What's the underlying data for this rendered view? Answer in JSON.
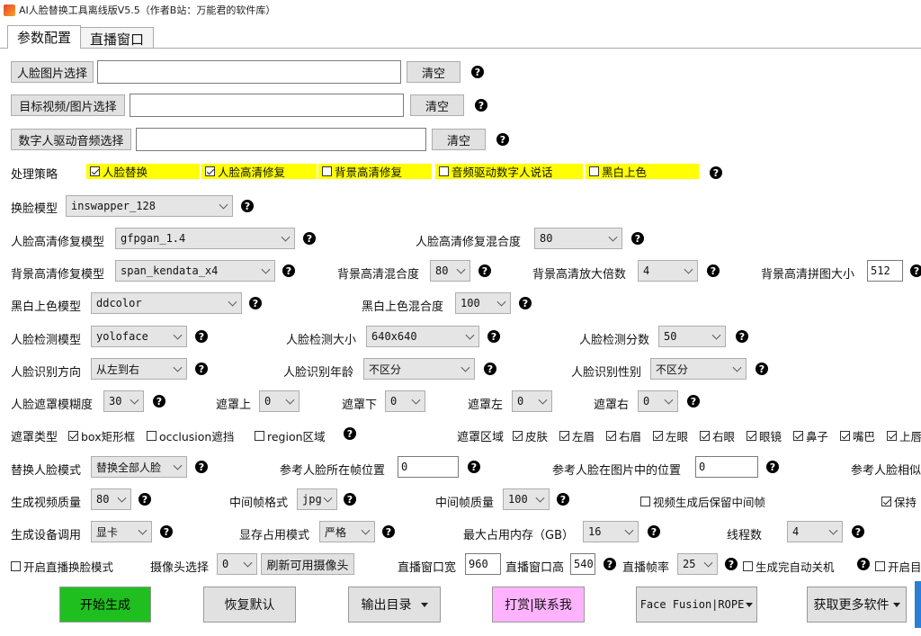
{
  "window": {
    "title": "AI人脸替换工具离线版V5.5（作者B站：万能君的软件库）"
  },
  "tabs": [
    "参数配置",
    "直播窗口"
  ],
  "file_rows": [
    {
      "button": "人脸图片选择",
      "value": "",
      "clear": "清空"
    },
    {
      "button": "目标视频/图片选择",
      "value": "",
      "clear": "清空"
    },
    {
      "button": "数字人驱动音频选择",
      "value": "",
      "clear": "清空"
    }
  ],
  "strategy": {
    "label": "处理策略",
    "options": [
      {
        "label": "人脸替换",
        "checked": true
      },
      {
        "label": "人脸高清修复",
        "checked": true
      },
      {
        "label": "背景高清修复",
        "checked": false
      },
      {
        "label": "音频驱动数字人说话",
        "checked": false
      },
      {
        "label": "黑白上色",
        "checked": false
      }
    ]
  },
  "swap_model": {
    "label": "换脸模型",
    "value": "inswapper_128"
  },
  "face_enhance": {
    "label": "人脸高清修复模型",
    "value": "gfpgan_1.4",
    "blend_label": "人脸高清修复混合度",
    "blend": "80"
  },
  "bg_enhance": {
    "label": "背景高清修复模型",
    "value": "span_kendata_x4",
    "blend_label": "背景高清混合度",
    "blend": "80",
    "scale_label": "背景高清放大倍数",
    "scale": "4",
    "tile_label": "背景高清拼图大小",
    "tile": "512"
  },
  "colorize": {
    "label": "黑白上色模型",
    "value": "ddcolor",
    "blend_label": "黑白上色混合度",
    "blend": "100"
  },
  "detect": {
    "label": "人脸检测模型",
    "value": "yoloface",
    "size_label": "人脸检测大小",
    "size": "640x640",
    "score_label": "人脸检测分数",
    "score": "50"
  },
  "recog": {
    "label": "人脸识别方向",
    "value": "从左到右",
    "age_label": "人脸识别年龄",
    "age": "不区分",
    "gender_label": "人脸识别性别",
    "gender": "不区分"
  },
  "mask": {
    "blur_label": "人脸遮罩模糊度",
    "blur": "30",
    "top_label": "遮罩上",
    "top": "0",
    "bottom_label": "遮罩下",
    "bottom": "0",
    "left_label": "遮罩左",
    "left": "0",
    "right_label": "遮罩右",
    "right": "0"
  },
  "mask_type": {
    "label": "遮罩类型",
    "options": [
      {
        "label": "box矩形框",
        "checked": true
      },
      {
        "label": "occlusion遮挡",
        "checked": false
      },
      {
        "label": "region区域",
        "checked": false
      }
    ]
  },
  "mask_region": {
    "label": "遮罩区域",
    "options": [
      {
        "label": "皮肤",
        "checked": true
      },
      {
        "label": "左眉",
        "checked": true
      },
      {
        "label": "右眉",
        "checked": true
      },
      {
        "label": "左眼",
        "checked": true
      },
      {
        "label": "右眼",
        "checked": true
      },
      {
        "label": "眼镜",
        "checked": true
      },
      {
        "label": "鼻子",
        "checked": true
      },
      {
        "label": "嘴巴",
        "checked": true
      },
      {
        "label": "上唇",
        "checked": true
      }
    ]
  },
  "replace_mode": {
    "label": "替换人脸模式",
    "value": "替换全部人脸",
    "ref_pos_label": "参考人脸所在帧位置",
    "ref_pos": "0",
    "ref_img_label": "参考人脸在图片中的位置",
    "ref_img": "0",
    "ref_sim_label": "参考人脸相似"
  },
  "output": {
    "quality_label": "生成视频质量",
    "quality": "80",
    "frame_fmt_label": "中间帧格式",
    "frame_fmt": "jpg",
    "frame_q_label": "中间帧质量",
    "frame_q": "100",
    "keep_frames_label": "视频生成后保留中间帧",
    "keep_frames": false,
    "keep_label": "保持",
    "keep": true
  },
  "device": {
    "label": "生成设备调用",
    "value": "显卡",
    "vram_label": "显存占用模式",
    "vram": "严格",
    "maxmem_label": "最大占用内存（GB）",
    "maxmem": "16",
    "threads_label": "线程数",
    "threads": "4"
  },
  "live": {
    "mode_label": "开启直播换脸模式",
    "mode": false,
    "cam_label": "摄像头选择",
    "cam": "0",
    "refresh": "刷新可用摄像头",
    "w_label": "直播窗口宽",
    "w": "960",
    "h_label": "直播窗口高",
    "h": "540",
    "fps_label": "直播帧率",
    "fps": "25",
    "shutdown_label": "生成完自动关机",
    "shutdown": false,
    "open_label": "开启目",
    "open": false
  },
  "actions": {
    "start": "开始生成",
    "reset": "恢复默认",
    "outdir": "输出目录",
    "donate": "打赏|联系我",
    "engine": "Face Fusion|ROPE",
    "more": "获取更多软件"
  },
  "colors": {
    "start": "#1fbf1f",
    "donate": "#ffb3ff",
    "highlight": "#ffff00"
  },
  "help_icon": "?"
}
